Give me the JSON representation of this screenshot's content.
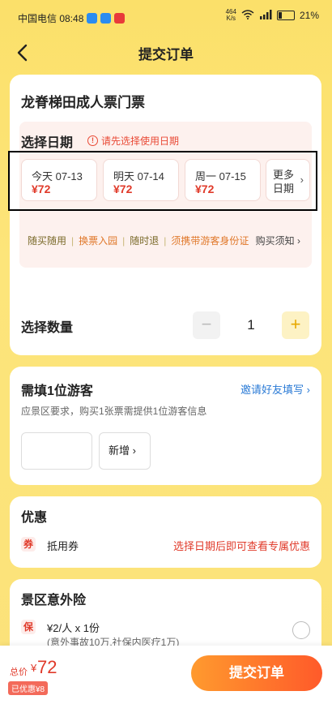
{
  "status": {
    "carrier_time": "中国电信 08:48",
    "net_speed": "464\nK/s",
    "battery": "21%",
    "colors": [
      "#2a8cf0",
      "#2a8cf0",
      "#e83a3a"
    ]
  },
  "nav": {
    "title": "提交订单"
  },
  "product": {
    "title": "龙脊梯田成人票门票"
  },
  "date": {
    "label": "选择日期",
    "warning": "请先选择使用日期",
    "options": [
      {
        "day": "今天 07-13",
        "price": "¥72"
      },
      {
        "day": "明天 07-14",
        "price": "¥72"
      },
      {
        "day": "周一 07-15",
        "price": "¥72"
      }
    ],
    "more": "更多日期",
    "tags": [
      "随买随用",
      "换票入园",
      "随时退",
      "须携带游客身份证"
    ],
    "notice": "购买须知"
  },
  "quantity": {
    "label": "选择数量",
    "value": "1",
    "minus": "−",
    "plus": "+"
  },
  "tourist": {
    "title": "需填1位游客",
    "invite": "邀请好友填写",
    "desc": "应景区要求，购买1张票需提供1位游客信息",
    "add": "新增"
  },
  "promo": {
    "title": "优惠",
    "icon_text": "券",
    "coupon_label": "抵用券",
    "coupon_hint": "选择日期后即可查看专属优惠"
  },
  "insurance": {
    "title": "景区意外险",
    "icon_text": "保",
    "price": "¥2/人 x 1份",
    "desc": "(意外事故10万,社保内医疗1万)"
  },
  "bottom": {
    "total_label": "总价",
    "currency": "¥",
    "total": "72",
    "discount": "已优惠¥8",
    "submit": "提交订单"
  }
}
